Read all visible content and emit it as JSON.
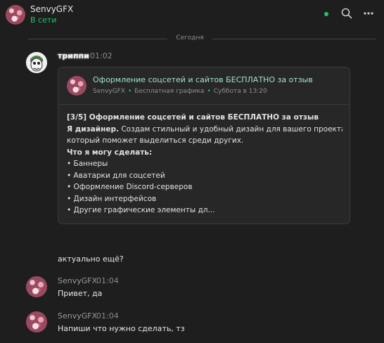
{
  "header": {
    "name": "SenvyGFX",
    "status": "В сети"
  },
  "day_separator": "Сегодня",
  "messages": [
    {
      "author": "триппи",
      "time": "01:02",
      "card": {
        "title": "Оформление соцсетей и сайтов БЕСПЛАТНО за отзыв",
        "meta_author": "SenvyGFX",
        "meta_category": "Бесплатная графика",
        "meta_date": "Суббота в 13:20",
        "body_title": "[3/5] Оформление соцсетей и сайтов БЕСПЛАТНО за отзыв",
        "intro_bold": "Я дизайнер.",
        "intro_rest": " Создам стильный и удобный дизайн для вашего проекта,",
        "intro_line2": "который поможет выделиться среди других.",
        "list_title": "Что я могу сделать:",
        "items": [
          "• Баннеры",
          "• Аватарки для соцсетей",
          "• Оформление Discord-серверов",
          "• Дизайн интерфейсов",
          "• Другие графические элементы дл..."
        ]
      },
      "followup": "актуально ещё?"
    },
    {
      "author": "SenvyGFX",
      "time": "01:04",
      "text": "Привет, да"
    },
    {
      "author": "SenvyGFX",
      "time": "01:04",
      "text": "Напиши что нужно сделать, тз"
    }
  ]
}
